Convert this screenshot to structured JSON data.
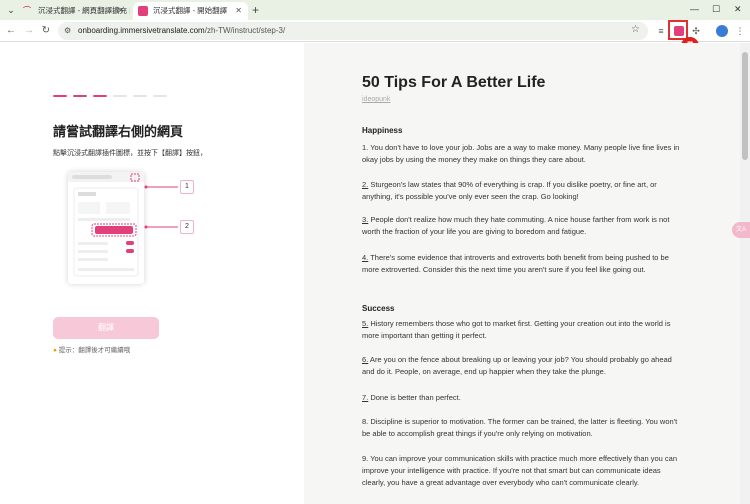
{
  "browser": {
    "tabs": [
      {
        "title": "沉浸式翻譯 - 網頁翻譯擴充 | PDF",
        "active": false
      },
      {
        "title": "沉浸式翻譯 - 開始翻譯",
        "active": true
      }
    ],
    "url_domain": "onboarding.immersivetranslate.com",
    "url_path": "/zh-TW/instruct/step-3/",
    "step_badge": "7",
    "colors": {
      "accent": "#e2407a",
      "highlight_box": "#e03030"
    }
  },
  "onboarding": {
    "heading": "請嘗試翻譯右側的網頁",
    "instruction": "點擊沉浸式翻譯插件圖標，並按下【翻譯】按鈕，",
    "callouts": [
      "1",
      "2"
    ],
    "translate_button": "翻譯",
    "hint": "提示：翻譯後才可繼續哦",
    "progress": {
      "done": 3,
      "total": 6
    }
  },
  "article": {
    "title": "50 Tips For A Better Life",
    "author": "ideopunk",
    "sections": [
      {
        "heading": "Happiness",
        "items": [
          {
            "n": "",
            "text": "1. You don't have to love your job. Jobs are a way to make money. Many people live fine lives in okay jobs by using the money they make on things they care about."
          },
          {
            "n": "2.",
            "text": " Sturgeon's law states that 90% of everything is crap. If you dislike poetry, or fine art, or anything, it's possible you've only ever seen the crap. Go looking!"
          },
          {
            "n": "3.",
            "text": " People don't realize how much they hate commuting. A nice house farther from work is not worth the fraction of your life you are giving to boredom and fatigue."
          },
          {
            "n": "4.",
            "text": " There's some evidence that introverts and extroverts both benefit from being pushed to be more extroverted. Consider this the next time you aren't sure if you feel like going out."
          }
        ]
      },
      {
        "heading": "Success",
        "items": [
          {
            "n": "5.",
            "text": " History remembers those who got to market first. Getting your creation out into the world is more important than getting it perfect."
          },
          {
            "n": "6.",
            "text": " Are you on the fence about breaking up or leaving your job? You should probably go ahead and do it. People, on average, end up happier when they take the plunge."
          },
          {
            "n": "7.",
            "text": " Done is better than perfect."
          },
          {
            "n": "",
            "text": "8. Discipline is superior to motivation. The former can be trained, the latter is fleeting. You won't be able to accomplish great things if you're only relying on motivation."
          },
          {
            "n": "",
            "text": "9. You can improve your communication skills with practice much more effectively than you can improve your intelligence with practice. If you're not that smart but can communicate ideas clearly, you have a great advantage over everybody who can't communicate clearly."
          }
        ]
      }
    ]
  },
  "float_button_label": "文A"
}
